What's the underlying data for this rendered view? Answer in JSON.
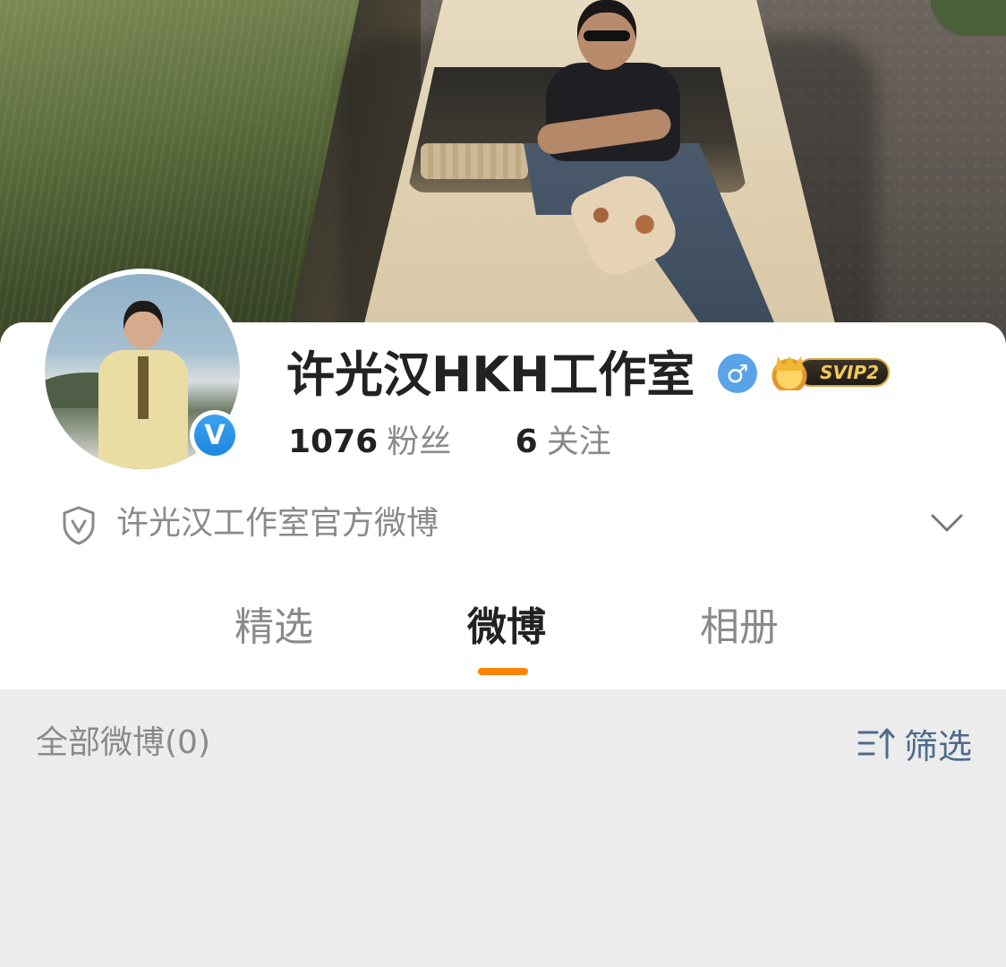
{
  "profile": {
    "name": "许光汉HKH工作室",
    "gender_icon": "male-icon",
    "vip_badge": "SVIP2",
    "followers_count": "1076",
    "followers_label": "粉丝",
    "following_count": "6",
    "following_label": "关注",
    "description": "许光汉工作室官方微博",
    "verified_mark": "V"
  },
  "tabs": [
    {
      "label": "精选",
      "active": false
    },
    {
      "label": "微博",
      "active": true
    },
    {
      "label": "相册",
      "active": false
    }
  ],
  "list": {
    "all_posts_label": "全部微博(0)",
    "filter_label": "筛选"
  },
  "colors": {
    "accent": "#ff8200",
    "link": "#4e6b8c",
    "verified": "#1f86e0",
    "background": "#ececec"
  }
}
